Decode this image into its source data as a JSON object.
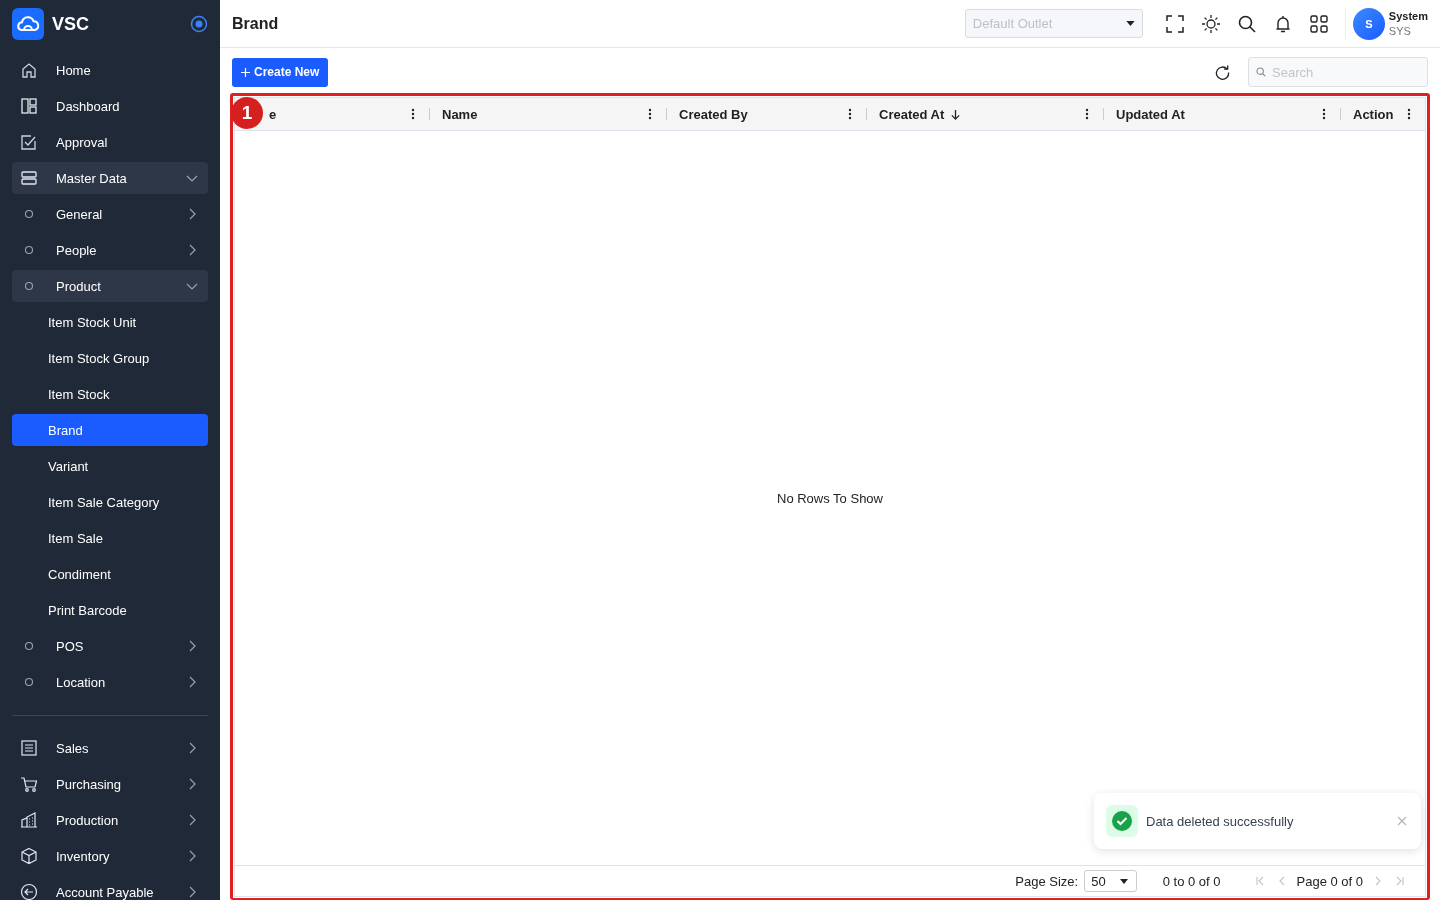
{
  "app": {
    "name": "VSC"
  },
  "sidebar": {
    "items": [
      {
        "label": "Home"
      },
      {
        "label": "Dashboard"
      },
      {
        "label": "Approval"
      },
      {
        "label": "Master Data",
        "expanded": true,
        "children": [
          {
            "label": "General",
            "expanded": false
          },
          {
            "label": "People",
            "expanded": false
          },
          {
            "label": "Product",
            "expanded": true,
            "children": [
              {
                "label": "Item Stock Unit",
                "selected": false
              },
              {
                "label": "Item Stock Group",
                "selected": false
              },
              {
                "label": "Item Stock",
                "selected": false
              },
              {
                "label": "Brand",
                "selected": true
              },
              {
                "label": "Variant",
                "selected": false
              },
              {
                "label": "Item Sale Category",
                "selected": false
              },
              {
                "label": "Item Sale",
                "selected": false
              },
              {
                "label": "Condiment",
                "selected": false
              },
              {
                "label": "Print Barcode",
                "selected": false
              }
            ]
          },
          {
            "label": "POS",
            "expanded": false
          },
          {
            "label": "Location",
            "expanded": false
          }
        ]
      }
    ],
    "modules": [
      {
        "label": "Sales",
        "expanded": false
      },
      {
        "label": "Purchasing",
        "expanded": false
      },
      {
        "label": "Production",
        "expanded": false
      },
      {
        "label": "Inventory",
        "expanded": false
      },
      {
        "label": "Account Payable",
        "expanded": false
      }
    ]
  },
  "header": {
    "title": "Brand",
    "outlet": {
      "placeholder": "Default Outlet"
    },
    "user": {
      "initial": "S",
      "name": "System",
      "code": "SYS"
    }
  },
  "toolbar": {
    "create_button": "Create New",
    "search": {
      "placeholder": "Search"
    }
  },
  "table": {
    "columns": [
      {
        "label": "e",
        "sorted": false
      },
      {
        "label": "Name",
        "sorted": false
      },
      {
        "label": "Created By",
        "sorted": false
      },
      {
        "label": "Created At",
        "sorted": true
      },
      {
        "label": "Updated At",
        "sorted": false
      },
      {
        "label": "Action",
        "sorted": false
      }
    ],
    "empty_message": "No Rows To Show",
    "pager": {
      "page_size_label": "Page Size:",
      "page_size": "50",
      "range": "0 to 0 of 0",
      "page": "Page 0 of 0",
      "first_disabled": true,
      "prev_disabled": true,
      "next_disabled": true,
      "last_disabled": true
    }
  },
  "annotation": {
    "label": "1"
  },
  "toast": {
    "message": "Data deleted successfully"
  }
}
